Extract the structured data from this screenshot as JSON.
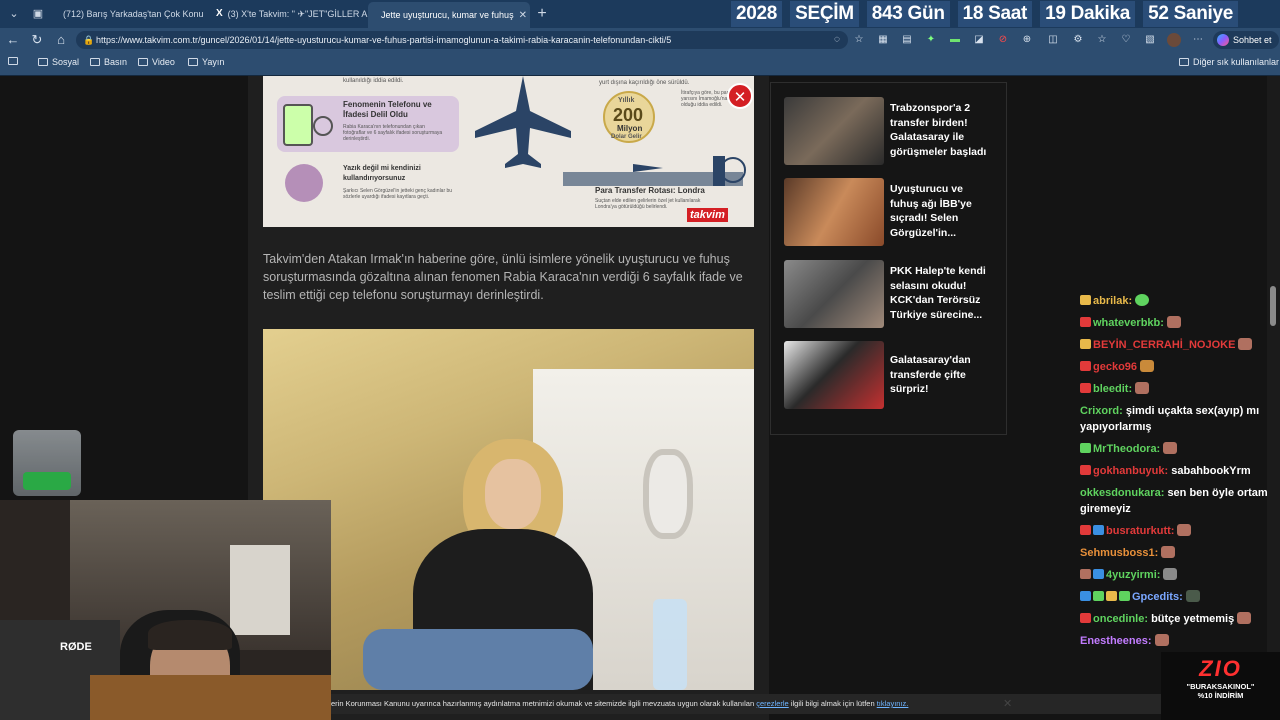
{
  "tabs": [
    {
      "title": "(712) Barış Yarkadaş'tan Çok Konu",
      "favicon": "youtube-icon"
    },
    {
      "title": "(3) X'te Takvim: \" ✈\"JET\"GİLLER A",
      "favicon": "x-icon"
    },
    {
      "title": "Jette uyuşturucu, kumar ve fuhuş",
      "favicon": "takvim-icon",
      "active": true
    }
  ],
  "countdown": {
    "year": "2028",
    "label": "SEÇİM",
    "days": "843 Gün",
    "hours": "18 Saat",
    "minutes": "19 Dakika",
    "seconds": "52 Saniye"
  },
  "address": {
    "url": "https://www.takvim.com.tr/guncel/2026/01/14/jette-uyusturucu-kumar-ve-fuhus-partisi-imamoglunun-a-takimi-rabia-karacanin-telefonundan-cikti/5"
  },
  "copilot_label": "Sohbet et",
  "bookmarks": {
    "items": [
      "Sosyal",
      "Basın",
      "Video",
      "Yayın"
    ],
    "other": "Diğer sık kullanılanlar"
  },
  "infographic": {
    "box1_title": "Fenomenin Telefonu ve İfadesi Delil Oldu",
    "box1_text": "Rabia Karaca'nın telefonundan çıkan fotoğraflar ve 6 sayfalık ifadesi soruşturmaya derinleştirdi.",
    "box2_title": "Yazık değil mi kendinizi kullandırıyorsunuz",
    "box2_text": "Şarkıcı Selen Görgüzel'in jetteki genç kadınlar bu sözlerle uyardığı ifadesi kayıtlara geçti.",
    "top_text": "kullanıldığı iddia edildi.",
    "top_right_text": "yurt dışına kaçırıldığı öne sürüldü.",
    "yearly_label": "Yıllık",
    "amount": "200",
    "amount_unit": "Milyon",
    "amount_sub": "Dolar Gelir",
    "side_text": "İtirafçıya göre, bu paranın yarısını İmamoğlu'na ait olduğu iddia edildi.",
    "route_title": "Para Transfer Rotası: Londra",
    "route_text": "Suçtan elde edilen gelirlerin özel jet kullanılarak Londra'ya götürüldüğü belirlendi.",
    "brand": "takvim"
  },
  "article": {
    "paragraph": "Takvim'den Atakan Irmak'ın haberine göre, ünlü isimlere yönelik uyuşturucu ve fuhuş soruşturmasında gözaltına alınan fenomen Rabia Karaca'nın verdiği 6 sayfalık ifade ve teslim ettiği cep telefonu soruşturmayı derinleştirdi."
  },
  "news": [
    {
      "title": "Trabzonspor'a 2 transfer birden! Galatasaray ile görüşmeler başladı"
    },
    {
      "title": "Uyuşturucu ve fuhuş ağı İBB'ye sıçradı! Selen Görgüzel'in..."
    },
    {
      "title": "PKK Halep'te kendi selasını okudu! KCK'dan Terörsüz Türkiye sürecine..."
    },
    {
      "title": "Galatasaray'dan transferde çifte sürpriz!"
    }
  ],
  "chat": [
    {
      "user": "abrilak:",
      "text": "",
      "color": "#e8b94a",
      "badge": "#e8b94a"
    },
    {
      "user": "whateverbkb:",
      "text": "",
      "color": "#5fd35f",
      "badge": "#e23a3a"
    },
    {
      "user": "BEYİN_CERRAHİ_NOJOKE",
      "text": "",
      "color": "#e23a3a",
      "badge": "#e8b94a"
    },
    {
      "user": "gecko96",
      "text": "",
      "color": "#e23a3a",
      "badge": "#e23a3a"
    },
    {
      "user": "bleedit:",
      "text": "",
      "color": "#5fd35f",
      "badge": "#e23a3a"
    },
    {
      "user": "Crixord:",
      "text": "şimdi uçakta sex(ayıp) mı yapıyorlarmış",
      "color": "#5fd35f",
      "badge": ""
    },
    {
      "user": "MrTheodora:",
      "text": "",
      "color": "#5fd35f",
      "badge": "#5fd35f"
    },
    {
      "user": "gokhanbuyuk:",
      "text": "sabahbookYrm",
      "color": "#e23a3a",
      "badge": "#e23a3a"
    },
    {
      "user": "okkesdonukara:",
      "text": "sen ben öyle ortama giremeyiz",
      "color": "#5fd35f",
      "badge": ""
    },
    {
      "user": "busraturkutt:",
      "text": "",
      "color": "#e23a3a",
      "badge": "#e23a3a"
    },
    {
      "user": "Sehmusboss1:",
      "text": "",
      "color": "#e8903a",
      "badge": ""
    },
    {
      "user": "4yuzyirmi:",
      "text": "",
      "color": "#5fd35f",
      "badge": "#b07060"
    },
    {
      "user": "Gpcedits:",
      "text": "",
      "color": "#7aa7ff",
      "badge": "#3a8fe2"
    },
    {
      "user": "oncedinle:",
      "text": "bütçe yetmemiş",
      "color": "#5fd35f",
      "badge": "#e23a3a"
    },
    {
      "user": "Enestheenes:",
      "text": "",
      "color": "#c27cff",
      "badge": ""
    }
  ],
  "cookie": {
    "text": "erin Korunması Kanunu uyarınca hazırlanmış aydınlatma metnimizi okumak ve sitemizde ilgili mevzuata uygun olarak kullanılan",
    "link1": "çerezlerle",
    "middle": "ilgili bilgi almak için lütfen",
    "link2": "tıklayınız."
  },
  "promo": {
    "logo": "ZIO",
    "code": "\"BURAKSAKINOL\"",
    "discount": "%10 İNDİRİM"
  },
  "webcam": {
    "mic_label": "RØDE"
  },
  "colors": {
    "tabbar": "#1c3a5c",
    "toolbar": "#2d4d70",
    "page_bg": "#141414",
    "accent_red": "#d41f24"
  }
}
